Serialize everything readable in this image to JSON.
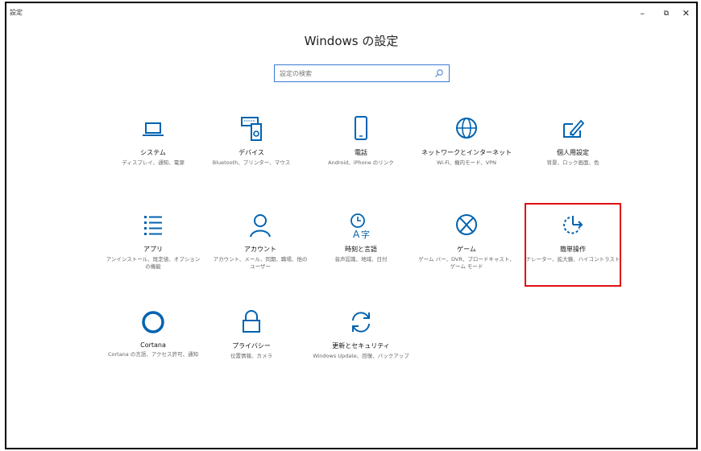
{
  "window": {
    "title": "設定",
    "min_glyph": "–",
    "max_glyph": "⧉",
    "close_glyph": "✕"
  },
  "page": {
    "title": "Windows の設定"
  },
  "search": {
    "placeholder": "設定の検索",
    "value": ""
  },
  "tiles": [
    {
      "label": "システム",
      "desc": "ディスプレイ、通知、電源",
      "icon": "laptop-icon"
    },
    {
      "label": "デバイス",
      "desc": "Bluetooth、プリンター、マウス",
      "icon": "devices-icon"
    },
    {
      "label": "電話",
      "desc": "Android、iPhone のリンク",
      "icon": "phone-icon"
    },
    {
      "label": "ネットワークとインターネット",
      "desc": "Wi-Fi、機内モード、VPN",
      "icon": "globe-icon"
    },
    {
      "label": "個人用設定",
      "desc": "背景、ロック画面、色",
      "icon": "personalization-icon"
    },
    {
      "label": "アプリ",
      "desc": "アンインストール、既定値、オプションの機能",
      "icon": "apps-list-icon"
    },
    {
      "label": "アカウント",
      "desc": "アカウント、メール、同期、職場、他のユーザー",
      "icon": "person-icon"
    },
    {
      "label": "時刻と言語",
      "desc": "音声認識、地域、日付",
      "icon": "time-language-icon"
    },
    {
      "label": "ゲーム",
      "desc": "ゲーム バー、DVR、ブロードキャスト、ゲーム モード",
      "icon": "xbox-icon"
    },
    {
      "label": "簡単操作",
      "desc": "ナレーター、拡大鏡、ハイコントラスト",
      "icon": "ease-of-access-icon"
    },
    {
      "label": "Cortana",
      "desc": "Cortana の言語、アクセス許可、通知",
      "icon": "cortana-icon"
    },
    {
      "label": "プライバシー",
      "desc": "位置情報、カメラ",
      "icon": "lock-icon"
    },
    {
      "label": "更新とセキュリティ",
      "desc": "Windows Update、回復、バックアップ",
      "icon": "update-sync-icon"
    }
  ],
  "colors": {
    "accent": "#0063b1",
    "highlight_box": "#e01010",
    "search_border": "#3a7bd5"
  }
}
